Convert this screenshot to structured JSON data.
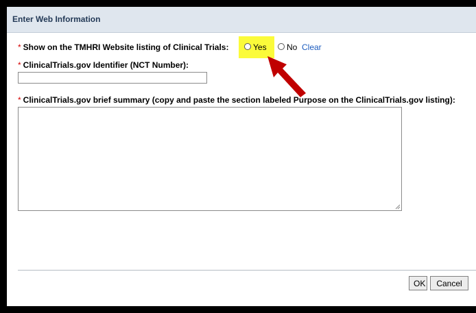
{
  "dialog": {
    "title": "Enter Web Information"
  },
  "fields": {
    "required_marker": "*",
    "show_on_website": {
      "label": "Show on the TMHRI Website listing of Clinical Trials:",
      "options": [
        "Yes",
        "No"
      ],
      "selected": null,
      "clear_label": "Clear"
    },
    "nct_number": {
      "label": "ClinicalTrials.gov Identifier (NCT Number):",
      "value": ""
    },
    "brief_summary": {
      "label": "ClinicalTrials.gov brief summary (copy and paste the section labeled Purpose on the ClinicalTrials.gov listing):",
      "value": ""
    }
  },
  "buttons": {
    "ok": "OK",
    "cancel": "Cancel"
  },
  "annotation": {
    "highlight_color": "#fbfb3a",
    "arrow_color": "#c00000"
  }
}
